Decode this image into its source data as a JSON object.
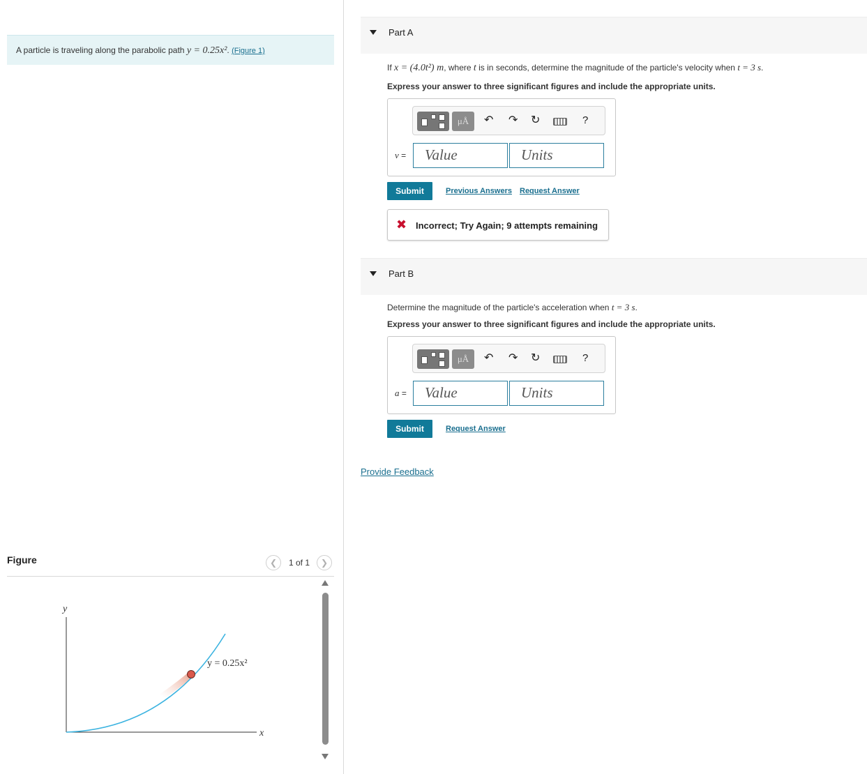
{
  "problem": {
    "intro_text": "A particle is traveling along the parabolic path",
    "intro_equation": "y = 0.25x²",
    "figure_link": "(Figure 1)"
  },
  "figure": {
    "title": "Figure",
    "pager": "1 of 1",
    "axis_y": "y",
    "axis_x": "x",
    "curve_label": "y = 0.25x²"
  },
  "partA": {
    "title": "Part A",
    "q_prefix": "If",
    "q_equation": "x = (4.0t²) m",
    "q_mid": ", where",
    "q_var": "t",
    "q_rest": "is in seconds, determine the magnitude of the particle's velocity when",
    "q_time": "t = 3 s",
    "instruction": "Express your answer to three significant figures and include the appropriate units.",
    "var_label": "v",
    "value_placeholder": "Value",
    "units_placeholder": "Units",
    "submit": "Submit",
    "previous_answers": "Previous Answers",
    "request_answer": "Request Answer",
    "feedback": "Incorrect; Try Again; 9 attempts remaining"
  },
  "partB": {
    "title": "Part B",
    "q_text": "Determine the magnitude of the particle's acceleration when",
    "q_time": "t = 3 s",
    "instruction": "Express your answer to three significant figures and include the appropriate units.",
    "var_label": "a",
    "value_placeholder": "Value",
    "units_placeholder": "Units",
    "submit": "Submit",
    "request_answer": "Request Answer"
  },
  "provide_feedback": "Provide Feedback",
  "colors": {
    "accent": "#117a99",
    "link": "#1a6f8f",
    "error": "#c8102e",
    "curve": "#3bb3e0",
    "particle": "#d9594c"
  },
  "toolbar_icons": [
    "templates-icon",
    "units-mu-icon",
    "undo-icon",
    "redo-icon",
    "reset-icon",
    "keyboard-icon",
    "help-icon"
  ]
}
